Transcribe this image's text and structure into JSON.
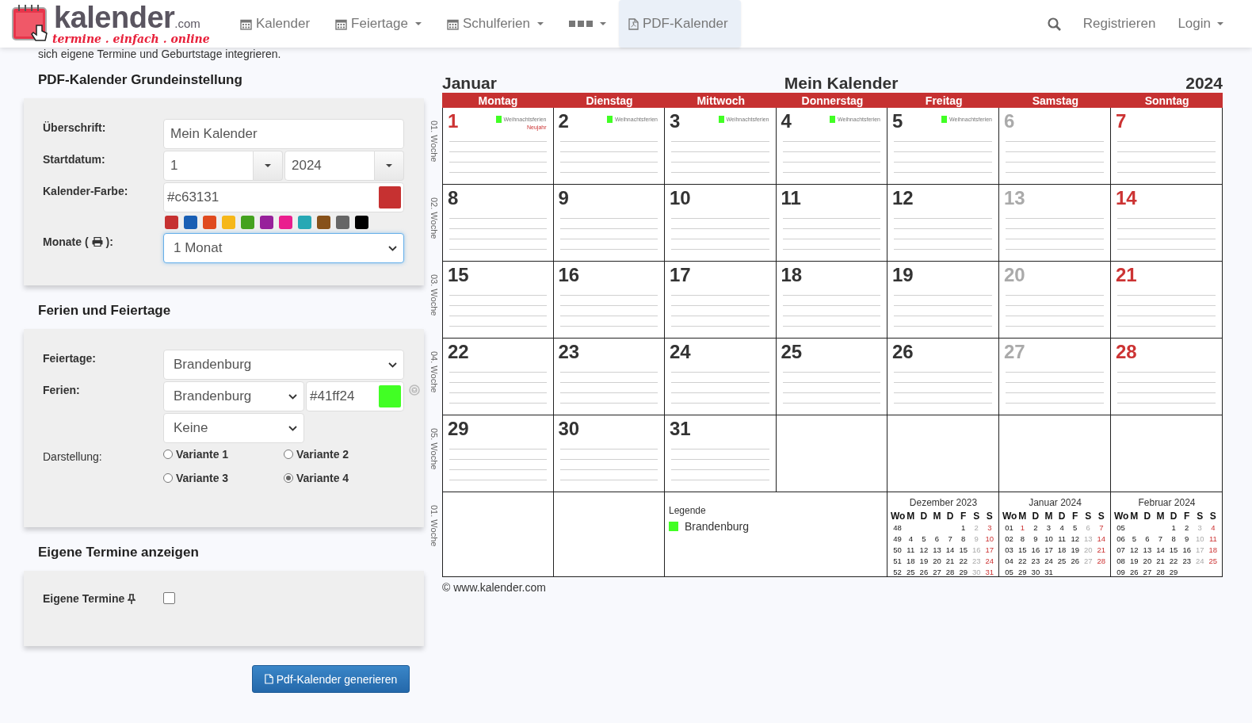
{
  "header": {
    "logo": {
      "word": "kalender",
      "suffix": ".com",
      "slogan": "termine . einfach . online"
    },
    "nav": [
      {
        "label": "Kalender",
        "kind": "calendar",
        "dropdown": false,
        "selected": false
      },
      {
        "label": "Feiertage",
        "kind": "calendar",
        "dropdown": true,
        "selected": false
      },
      {
        "label": "Schulferien",
        "kind": "calendar",
        "dropdown": true,
        "selected": false
      },
      {
        "kind": "more",
        "dropdown": true,
        "selected": false
      },
      {
        "label": "PDF-Kalender",
        "kind": "pdf",
        "dropdown": false,
        "selected": true
      }
    ],
    "actions": [
      {
        "kind": "search"
      },
      {
        "kind": "link",
        "label": "Registrieren",
        "dropdown": false
      },
      {
        "kind": "link",
        "label": "Login",
        "dropdown": true
      }
    ]
  },
  "intro": "sich eigene Termine und Geburtstage integrieren.",
  "settings": {
    "basic": {
      "title": "PDF-Kalender Grundeinstellung",
      "heading_label": "Überschrift:",
      "heading_value": "Mein Kalender",
      "start_label": "Startdatum:",
      "start_month": "1",
      "start_year": "2024",
      "color_label": "Kalender-Farbe:",
      "color_value": "#c63131",
      "palette": [
        {
          "color": "#c63131"
        },
        {
          "color": "#1a5fb4"
        },
        {
          "color": "#e04a1e"
        },
        {
          "color": "#f6b719"
        },
        {
          "color": "#44a21f"
        },
        {
          "color": "#97219b"
        },
        {
          "color": "#ea1e8e"
        },
        {
          "color": "#27a8b4"
        },
        {
          "color": "#87511a"
        },
        {
          "color": "#666666"
        },
        {
          "color": "#000000"
        }
      ],
      "months_label_before": "Monate (",
      "months_label_after": "):",
      "months_value": "1 Monat"
    },
    "holidays": {
      "title": "Ferien und Feiertage",
      "feiertage_label": "Feiertage:",
      "feiertage_value": "Brandenburg",
      "ferien_label": "Ferien:",
      "ferien_value": "Brandenburg",
      "ferien_color": "#41ff24",
      "ferien_second": "Keine",
      "display_label": "Darstellung:",
      "variants": [
        {
          "label": "Variante 1",
          "selected": false
        },
        {
          "label": "Variante 2",
          "selected": false
        },
        {
          "label": "Variante 3",
          "selected": false
        },
        {
          "label": "Variante 4",
          "selected": true
        }
      ]
    },
    "own": {
      "title": "Eigene Termine anzeigen",
      "label": "Eigene Termine",
      "checked": false
    },
    "generate_button": "Pdf-Kalender generieren"
  },
  "calendar": {
    "month": "Januar",
    "title": "Mein Kalender",
    "year": "2024",
    "weekdays": [
      "Montag",
      "Dienstag",
      "Mittwoch",
      "Donnerstag",
      "Freitag",
      "Samstag",
      "Sonntag"
    ],
    "weeks": [
      {
        "label": "01. Woche",
        "days": [
          {
            "day": "1",
            "kind": "holiday",
            "vacation": "Weihnachtsferien",
            "holiday": "Neujahr"
          },
          {
            "day": "2",
            "kind": "weekday",
            "vacation": "Weihnachtsferien"
          },
          {
            "day": "3",
            "kind": "weekday",
            "vacation": "Weihnachtsferien"
          },
          {
            "day": "4",
            "kind": "weekday",
            "vacation": "Weihnachtsferien"
          },
          {
            "day": "5",
            "kind": "weekday",
            "vacation": "Weihnachtsferien"
          },
          {
            "day": "6",
            "kind": "saturday"
          },
          {
            "day": "7",
            "kind": "sunday"
          }
        ]
      },
      {
        "label": "02. Woche",
        "days": [
          {
            "day": "8",
            "kind": "weekday"
          },
          {
            "day": "9",
            "kind": "weekday"
          },
          {
            "day": "10",
            "kind": "weekday"
          },
          {
            "day": "11",
            "kind": "weekday"
          },
          {
            "day": "12",
            "kind": "weekday"
          },
          {
            "day": "13",
            "kind": "saturday"
          },
          {
            "day": "14",
            "kind": "sunday"
          }
        ]
      },
      {
        "label": "03. Woche",
        "days": [
          {
            "day": "15",
            "kind": "weekday"
          },
          {
            "day": "16",
            "kind": "weekday"
          },
          {
            "day": "17",
            "kind": "weekday"
          },
          {
            "day": "18",
            "kind": "weekday"
          },
          {
            "day": "19",
            "kind": "weekday"
          },
          {
            "day": "20",
            "kind": "saturday"
          },
          {
            "day": "21",
            "kind": "sunday"
          }
        ]
      },
      {
        "label": "04. Woche",
        "days": [
          {
            "day": "22",
            "kind": "weekday"
          },
          {
            "day": "23",
            "kind": "weekday"
          },
          {
            "day": "24",
            "kind": "weekday"
          },
          {
            "day": "25",
            "kind": "weekday"
          },
          {
            "day": "26",
            "kind": "weekday"
          },
          {
            "day": "27",
            "kind": "saturday"
          },
          {
            "day": "28",
            "kind": "sunday"
          }
        ]
      },
      {
        "label": "05. Woche",
        "days": [
          {
            "day": "29",
            "kind": "weekday"
          },
          {
            "day": "30",
            "kind": "weekday"
          },
          {
            "day": "31",
            "kind": "weekday"
          }
        ]
      }
    ],
    "footer_week": "01. Woche",
    "legend": {
      "title": "Legende",
      "items": [
        {
          "label": "Brandenburg"
        }
      ]
    },
    "minis": [
      {
        "title": "Dezember 2023",
        "header": [
          "Wo",
          "M",
          "D",
          "M",
          "D",
          "F",
          "S",
          "S"
        ],
        "rows": [
          {
            "week": "48",
            "align_end": true,
            "days": [
              "1",
              "2",
              "3"
            ]
          },
          {
            "week": "49",
            "days": [
              "4",
              "5",
              "6",
              "7",
              "8",
              "9",
              "10"
            ]
          },
          {
            "week": "50",
            "days": [
              "11",
              "12",
              "13",
              "14",
              "15",
              "16",
              "17"
            ]
          },
          {
            "week": "51",
            "days": [
              "18",
              "19",
              "20",
              "21",
              "22",
              "23",
              "24"
            ]
          },
          {
            "week": "52",
            "days": [
              "25",
              "26",
              "27",
              "28",
              "29",
              "30",
              "31"
            ]
          }
        ]
      },
      {
        "title": "Januar 2024",
        "header": [
          "Wo",
          "M",
          "D",
          "M",
          "D",
          "F",
          "S",
          "S"
        ],
        "rows": [
          {
            "week": "01",
            "days": [
              {
                "day": "1",
                "holiday": true
              },
              "2",
              "3",
              "4",
              "5",
              "6",
              "7"
            ]
          },
          {
            "week": "02",
            "days": [
              "8",
              "9",
              "10",
              "11",
              "12",
              "13",
              "14"
            ]
          },
          {
            "week": "03",
            "days": [
              "15",
              "16",
              "17",
              "18",
              "19",
              "20",
              "21"
            ]
          },
          {
            "week": "04",
            "days": [
              "22",
              "23",
              "24",
              "25",
              "26",
              "27",
              "28"
            ]
          },
          {
            "week": "05",
            "days": [
              "29",
              "30",
              "31"
            ]
          }
        ]
      },
      {
        "title": "Februar 2024",
        "header": [
          "Wo",
          "M",
          "D",
          "M",
          "D",
          "F",
          "S",
          "S"
        ],
        "rows": [
          {
            "week": "05",
            "align_end": true,
            "days": [
              "1",
              "2",
              "3",
              "4"
            ]
          },
          {
            "week": "06",
            "days": [
              "5",
              "6",
              "7",
              "8",
              "9",
              "10",
              "11"
            ]
          },
          {
            "week": "07",
            "days": [
              "12",
              "13",
              "14",
              "15",
              "16",
              "17",
              "18"
            ]
          },
          {
            "week": "08",
            "days": [
              "19",
              "20",
              "21",
              "22",
              "23",
              "24",
              "25"
            ]
          },
          {
            "week": "09",
            "days": [
              "26",
              "27",
              "28",
              "29"
            ]
          }
        ]
      }
    ],
    "copyright": "© www.kalender.com"
  }
}
